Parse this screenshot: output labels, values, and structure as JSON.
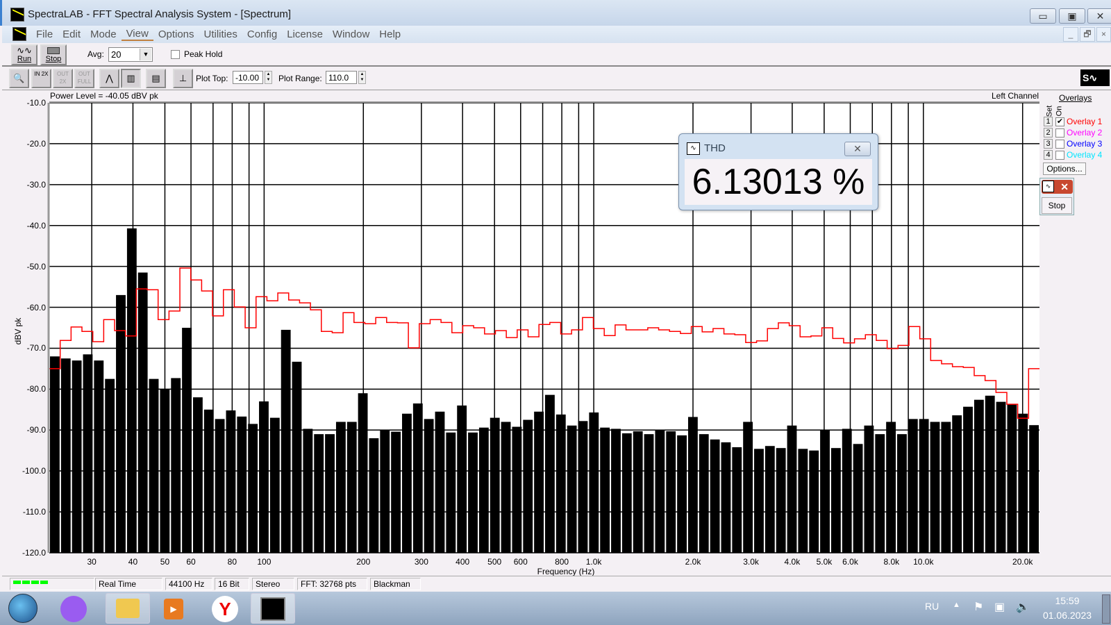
{
  "window": {
    "title": "SpectraLAB - FFT Spectral Analysis System - [Spectrum]",
    "minimize": "▭",
    "maximize": "▣",
    "close": "✕",
    "mdi_min": "_",
    "mdi_restore": "🗗",
    "mdi_close": "×"
  },
  "menu": [
    "File",
    "Edit",
    "Mode",
    "View",
    "Options",
    "Utilities",
    "Config",
    "License",
    "Window",
    "Help"
  ],
  "toolbar": {
    "run": "Run",
    "stop": "Stop",
    "avg_label": "Avg:",
    "avg_value": "20",
    "peak_hold": "Peak Hold",
    "peak_hold_checked": false,
    "plot_top_label": "Plot Top:",
    "plot_top": "-10.00",
    "plot_range_label": "Plot Range:",
    "plot_range": "110.0",
    "buttons": [
      "zoom",
      "zoom-in-2x",
      "zoom-out-2x",
      "zoom-out-full",
      "line-mode",
      "bar-mode",
      "settings-panel",
      "scale-marker"
    ],
    "zoom_in_text": "IN 2X",
    "zoom_out_text": "OUT 2X",
    "zoom_out_full_text": "OUT FULL"
  },
  "plot": {
    "power_level": "Power Level = -40.05 dBV pk",
    "channel": "Left Channel"
  },
  "overlays": {
    "title": "Overlays",
    "set_label": "Set",
    "on_label": "On",
    "options": "Options...",
    "items": [
      {
        "num": "1",
        "label": "Overlay 1",
        "color": "#ff0000",
        "on": true
      },
      {
        "num": "2",
        "label": "Overlay 2",
        "color": "#ff00ff",
        "on": false
      },
      {
        "num": "3",
        "label": "Overlay 3",
        "color": "#0000ff",
        "on": false
      },
      {
        "num": "4",
        "label": "Overlay 4",
        "color": "#00e5ff",
        "on": false
      }
    ]
  },
  "mini_window": {
    "stop": "Stop"
  },
  "thd": {
    "title": "THD",
    "value": "6.13013 %"
  },
  "status": {
    "mode": "Real Time",
    "rate": "44100 Hz",
    "bits": "16 Bit",
    "channels": "Stereo",
    "fft": "FFT: 32768 pts",
    "window": "Blackman"
  },
  "taskbar": {
    "lang": "RU",
    "time": "15:59",
    "date": "01.06.2023"
  },
  "chart_data": {
    "type": "bar",
    "title": "",
    "xlabel": "Frequency (Hz)",
    "ylabel": "dBV pk",
    "xscale": "log",
    "xlim": [
      22.3,
      22500
    ],
    "ylim": [
      -120,
      -10
    ],
    "yticks": [
      -10,
      -20,
      -30,
      -40,
      -50,
      -60,
      -70,
      -80,
      -90,
      -100,
      -110,
      -120
    ],
    "ytick_labels": [
      "-10.0",
      "-20.0",
      "-30.0",
      "-40.0",
      "-50.0",
      "-60.0",
      "-70.0",
      "-80.0",
      "-90.0",
      "-100.0",
      "-110.0",
      "-120.0"
    ],
    "xticks": [
      30,
      40,
      50,
      60,
      80,
      100,
      200,
      300,
      400,
      500,
      600,
      800,
      1000,
      2000,
      3000,
      4000,
      5000,
      6000,
      8000,
      10000,
      20000
    ],
    "xtick_labels": [
      "30",
      "40",
      "50",
      "60",
      "80",
      "100",
      "200",
      "300",
      "400",
      "500",
      "600",
      "800",
      "1.0k",
      "2.0k",
      "3.0k",
      "4.0k",
      "5.0k",
      "6.0k",
      "8.0k",
      "10.0k",
      "20.0k"
    ],
    "xgrid": [
      30,
      40,
      50,
      60,
      70,
      80,
      90,
      100,
      200,
      300,
      400,
      500,
      600,
      700,
      800,
      900,
      1000,
      2000,
      3000,
      4000,
      5000,
      6000,
      7000,
      8000,
      9000,
      10000,
      20000
    ],
    "grid": true,
    "series": [
      {
        "name": "Spectrum",
        "type": "bar",
        "color": "#000000",
        "values": [
          -72,
          -72.5,
          -73,
          -71.5,
          -73,
          -77.5,
          -57,
          -40.7,
          -51.5,
          -77.5,
          -80,
          -77.3,
          -65,
          -82,
          -85,
          -87.3,
          -85.2,
          -86.7,
          -88.5,
          -83,
          -87,
          -65.5,
          -73.3,
          -89.7,
          -91,
          -91,
          -88,
          -88,
          -81,
          -92,
          -90,
          -90.4,
          -86,
          -83.5,
          -87.3,
          -85.5,
          -90.6,
          -84,
          -90.6,
          -89.4,
          -87,
          -88,
          -89.2,
          -87.5,
          -85.5,
          -81.4,
          -86.2,
          -88.9,
          -87.8,
          -85.7,
          -89.4,
          -89.7,
          -90.8,
          -90.3,
          -91,
          -89.9,
          -90.3,
          -91.3,
          -86.8,
          -91,
          -92.3,
          -93,
          -94.2,
          -88,
          -94.6,
          -93.9,
          -94.4,
          -88.9,
          -94.6,
          -95,
          -90,
          -94.4,
          -89.7,
          -93.4,
          -88.9,
          -91,
          -88,
          -91,
          -87.3,
          -87.3,
          -88,
          -88,
          -86.4,
          -84.3,
          -82.6,
          -81.6,
          -83.1,
          -83.7,
          -86,
          -88.8
        ]
      },
      {
        "name": "Overlay 1",
        "type": "step",
        "color": "#ff0000",
        "values": [
          -75,
          -68.1,
          -64.8,
          -65.9,
          -68.4,
          -63,
          -65.7,
          -67,
          -55.5,
          -55.7,
          -63,
          -60.9,
          -50.4,
          -53.3,
          -56,
          -62.1,
          -55.7,
          -59.9,
          -65,
          -57.4,
          -58.4,
          -56.5,
          -58.2,
          -58.9,
          -60.6,
          -65.9,
          -66.2,
          -61.3,
          -63.7,
          -64,
          -62.5,
          -63.7,
          -63.8,
          -69.9,
          -64,
          -63,
          -63.7,
          -66.2,
          -64.5,
          -65,
          -66.5,
          -65.7,
          -67.4,
          -65.5,
          -67.2,
          -64.2,
          -63.7,
          -66.5,
          -65.5,
          -62.5,
          -65.2,
          -66.9,
          -64.3,
          -65.5,
          -65.5,
          -65,
          -65.5,
          -65.9,
          -66.4,
          -64.7,
          -66,
          -65.2,
          -66.5,
          -66.7,
          -68.6,
          -68.2,
          -65.2,
          -63.8,
          -64.5,
          -67.2,
          -67,
          -65,
          -67.6,
          -68.7,
          -67.7,
          -66.7,
          -68.1,
          -70.1,
          -69.3,
          -64.7,
          -67.7,
          -73,
          -73.8,
          -74.5,
          -74.7,
          -76.7,
          -77.9,
          -80.8,
          -83.7,
          -87.1,
          -75
        ]
      }
    ]
  }
}
